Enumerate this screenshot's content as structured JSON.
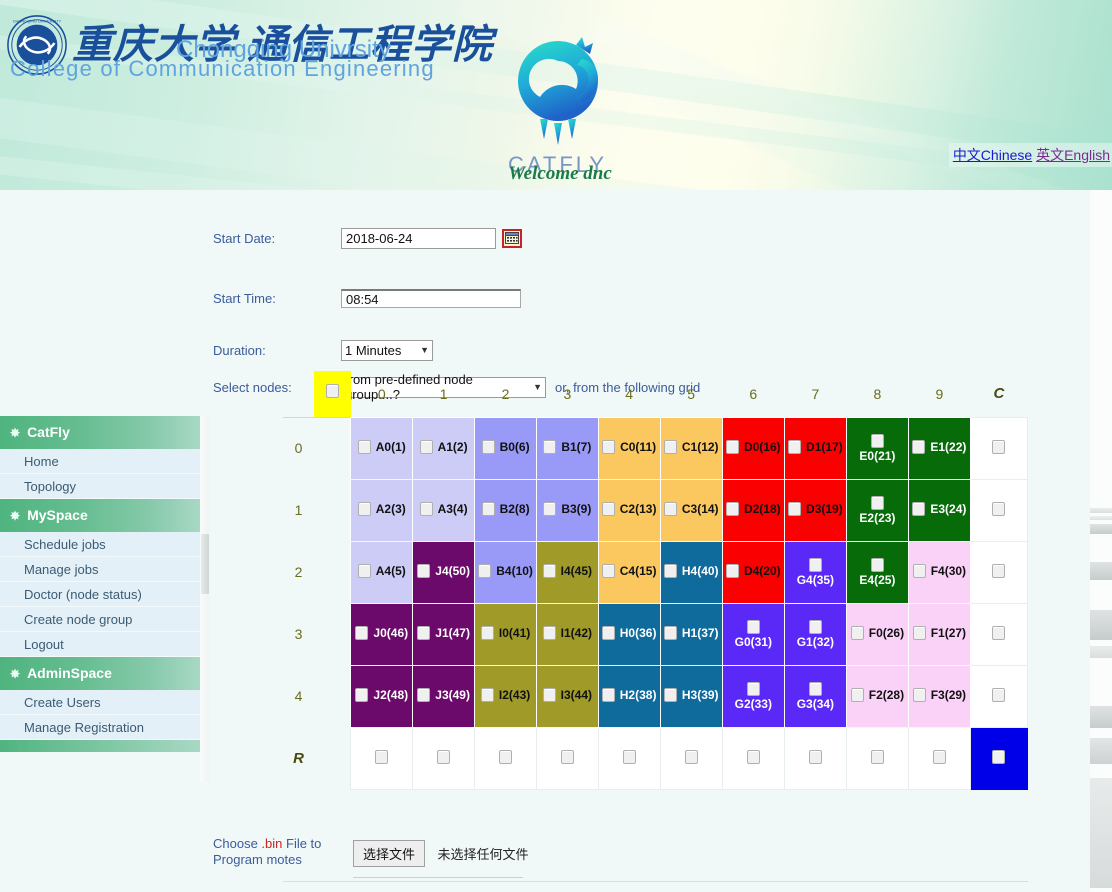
{
  "banner": {
    "university_cn": "重庆大学 通信工程学院",
    "university_en_line1": "Chongqing Univrsity",
    "university_en_line2": "College of Communication Engineering",
    "logo_word": "CATFLY",
    "welcome": "Welcome dnc",
    "lang_chinese": "中文Chinese",
    "lang_english": "英文English",
    "colors": {
      "link_unvisited": "#1919d2",
      "link_visited": "#7b2a8f",
      "banner_green": "#9fdcc6"
    }
  },
  "sidebar": {
    "groups": [
      {
        "title": "CatFly",
        "items": [
          "Home",
          "Topology"
        ]
      },
      {
        "title": "MySpace",
        "items": [
          "Schedule jobs",
          "Manage jobs",
          "Doctor (node status)",
          "Create node group",
          "Logout"
        ]
      },
      {
        "title": "AdminSpace",
        "items": [
          "Create Users",
          "Manage Registration"
        ]
      }
    ]
  },
  "form": {
    "start_date": {
      "label": "Start Date:",
      "value": "2018-06-24",
      "calendar_icon": "calendar-icon"
    },
    "start_time": {
      "label": "Start Time:",
      "value": "08:54"
    },
    "duration": {
      "label": "Duration:",
      "value": "1 Minutes"
    },
    "select_nodes": {
      "label": "Select nodes:",
      "value": "from pre-defined node group....?",
      "hint": "or, from the following grid"
    }
  },
  "grid": {
    "select_all_checked": false,
    "column_headers": [
      "0",
      "1",
      "2",
      "3",
      "4",
      "5",
      "6",
      "7",
      "8",
      "9",
      "C"
    ],
    "row_labels": [
      "0",
      "1",
      "2",
      "3",
      "4",
      "R"
    ],
    "colors": {
      "A": "#ccccf7",
      "B": "#9999f7",
      "C": "#fac85f",
      "D": "#fb0000",
      "E": "#086b0a",
      "F": "#fad2f7",
      "G": "#5a28f7",
      "H": "#0f6b9c",
      "I": "#a09b28",
      "J": "#6b0a6b",
      "blank": "#ffffff",
      "select_all": "#ffff00",
      "corner_selected": "#0000e8"
    },
    "rows": [
      {
        "label": "0",
        "cells": [
          {
            "label": "A0(1)",
            "color": "A",
            "stacked": false
          },
          {
            "label": "A1(2)",
            "color": "A",
            "stacked": false
          },
          {
            "label": "B0(6)",
            "color": "B",
            "stacked": false
          },
          {
            "label": "B1(7)",
            "color": "B",
            "stacked": false
          },
          {
            "label": "C0(11)",
            "color": "C",
            "stacked": false
          },
          {
            "label": "C1(12)",
            "color": "C",
            "stacked": false
          },
          {
            "label": "D0(16)",
            "color": "D",
            "stacked": false
          },
          {
            "label": "D1(17)",
            "color": "D",
            "stacked": false
          },
          {
            "label": "E0(21)",
            "color": "E",
            "stacked": true
          },
          {
            "label": "E1(22)",
            "color": "E",
            "stacked": false
          },
          {
            "label": "",
            "color": "blank",
            "stacked": false
          }
        ]
      },
      {
        "label": "1",
        "cells": [
          {
            "label": "A2(3)",
            "color": "A",
            "stacked": false
          },
          {
            "label": "A3(4)",
            "color": "A",
            "stacked": false
          },
          {
            "label": "B2(8)",
            "color": "B",
            "stacked": false
          },
          {
            "label": "B3(9)",
            "color": "B",
            "stacked": false
          },
          {
            "label": "C2(13)",
            "color": "C",
            "stacked": false
          },
          {
            "label": "C3(14)",
            "color": "C",
            "stacked": false
          },
          {
            "label": "D2(18)",
            "color": "D",
            "stacked": false
          },
          {
            "label": "D3(19)",
            "color": "D",
            "stacked": false
          },
          {
            "label": "E2(23)",
            "color": "E",
            "stacked": true
          },
          {
            "label": "E3(24)",
            "color": "E",
            "stacked": false
          },
          {
            "label": "",
            "color": "blank",
            "stacked": false
          }
        ]
      },
      {
        "label": "2",
        "cells": [
          {
            "label": "A4(5)",
            "color": "A",
            "stacked": false
          },
          {
            "label": "J4(50)",
            "color": "J",
            "stacked": false
          },
          {
            "label": "B4(10)",
            "color": "B",
            "stacked": false
          },
          {
            "label": "I4(45)",
            "color": "I",
            "stacked": false
          },
          {
            "label": "C4(15)",
            "color": "C",
            "stacked": false
          },
          {
            "label": "H4(40)",
            "color": "H",
            "stacked": false
          },
          {
            "label": "D4(20)",
            "color": "D",
            "stacked": false
          },
          {
            "label": "G4(35)",
            "color": "G",
            "stacked": true
          },
          {
            "label": "E4(25)",
            "color": "E",
            "stacked": true
          },
          {
            "label": "F4(30)",
            "color": "F",
            "stacked": false
          },
          {
            "label": "",
            "color": "blank",
            "stacked": false
          }
        ]
      },
      {
        "label": "3",
        "cells": [
          {
            "label": "J0(46)",
            "color": "J",
            "stacked": false
          },
          {
            "label": "J1(47)",
            "color": "J",
            "stacked": false
          },
          {
            "label": "I0(41)",
            "color": "I",
            "stacked": false
          },
          {
            "label": "I1(42)",
            "color": "I",
            "stacked": false
          },
          {
            "label": "H0(36)",
            "color": "H",
            "stacked": false
          },
          {
            "label": "H1(37)",
            "color": "H",
            "stacked": false
          },
          {
            "label": "G0(31)",
            "color": "G",
            "stacked": true
          },
          {
            "label": "G1(32)",
            "color": "G",
            "stacked": true
          },
          {
            "label": "F0(26)",
            "color": "F",
            "stacked": false
          },
          {
            "label": "F1(27)",
            "color": "F",
            "stacked": false
          },
          {
            "label": "",
            "color": "blank",
            "stacked": false
          }
        ]
      },
      {
        "label": "4",
        "cells": [
          {
            "label": "J2(48)",
            "color": "J",
            "stacked": false
          },
          {
            "label": "J3(49)",
            "color": "J",
            "stacked": false
          },
          {
            "label": "I2(43)",
            "color": "I",
            "stacked": false
          },
          {
            "label": "I3(44)",
            "color": "I",
            "stacked": false
          },
          {
            "label": "H2(38)",
            "color": "H",
            "stacked": false
          },
          {
            "label": "H3(39)",
            "color": "H",
            "stacked": false
          },
          {
            "label": "G2(33)",
            "color": "G",
            "stacked": true
          },
          {
            "label": "G3(34)",
            "color": "G",
            "stacked": true
          },
          {
            "label": "F2(28)",
            "color": "F",
            "stacked": false
          },
          {
            "label": "F3(29)",
            "color": "F",
            "stacked": false
          },
          {
            "label": "",
            "color": "blank",
            "stacked": false
          }
        ]
      },
      {
        "label": "R",
        "cells": [
          {
            "label": "",
            "color": "blank",
            "stacked": false
          },
          {
            "label": "",
            "color": "blank",
            "stacked": false
          },
          {
            "label": "",
            "color": "blank",
            "stacked": false
          },
          {
            "label": "",
            "color": "blank",
            "stacked": false
          },
          {
            "label": "",
            "color": "blank",
            "stacked": false
          },
          {
            "label": "",
            "color": "blank",
            "stacked": false
          },
          {
            "label": "",
            "color": "blank",
            "stacked": false
          },
          {
            "label": "",
            "color": "blank",
            "stacked": false
          },
          {
            "label": "",
            "color": "blank",
            "stacked": false
          },
          {
            "label": "",
            "color": "blank",
            "stacked": false
          },
          {
            "label": "",
            "color": "corner_selected",
            "stacked": false
          }
        ]
      }
    ]
  },
  "file_upload": {
    "label_part1": "Choose ",
    "label_red": ".bin",
    "label_part2": " File to Program motes",
    "button": "选择文件",
    "status": "未选择任何文件"
  }
}
